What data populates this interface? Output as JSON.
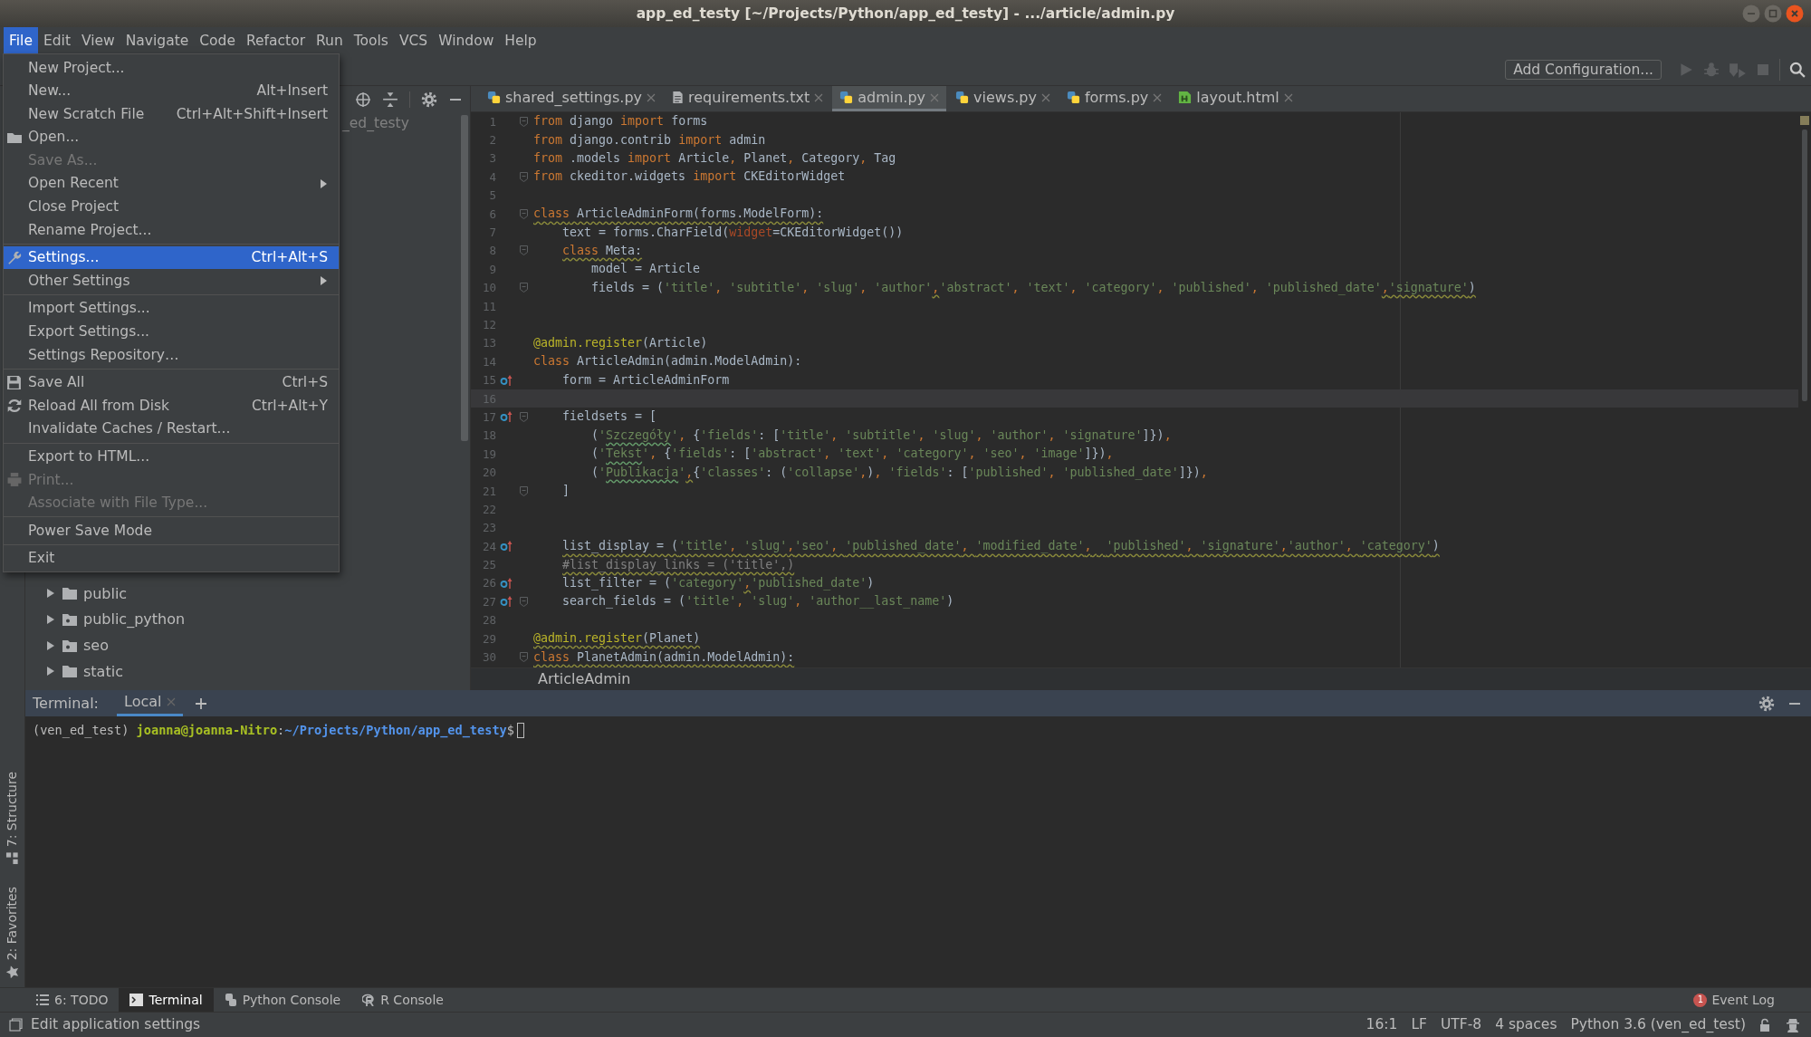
{
  "window": {
    "title": "app_ed_testy [~/Projects/Python/app_ed_testy] - .../article/admin.py"
  },
  "menu_bar": [
    {
      "label": "File",
      "selected": true
    },
    {
      "label": "Edit",
      "selected": false
    },
    {
      "label": "View",
      "selected": false
    },
    {
      "label": "Navigate",
      "selected": false
    },
    {
      "label": "Code",
      "selected": false
    },
    {
      "label": "Refactor",
      "selected": false
    },
    {
      "label": "Run",
      "selected": false
    },
    {
      "label": "Tools",
      "selected": false
    },
    {
      "label": "VCS",
      "selected": false
    },
    {
      "label": "Window",
      "selected": false
    },
    {
      "label": "Help",
      "selected": false
    }
  ],
  "file_menu": {
    "groups": [
      [
        {
          "label": "New Project...",
          "kind": "plain",
          "disabled": false,
          "selected": false,
          "submenu": false
        },
        {
          "label": "New...",
          "shortcut": "Alt+Insert",
          "kind": "plain",
          "disabled": false,
          "selected": false,
          "submenu": false
        },
        {
          "label": "New Scratch File",
          "shortcut": "Ctrl+Alt+Shift+Insert",
          "kind": "plain",
          "disabled": false,
          "selected": false,
          "submenu": false
        },
        {
          "label": "Open...",
          "kind": "folder",
          "disabled": false,
          "selected": false,
          "submenu": false
        },
        {
          "label": "Save As...",
          "kind": "plain",
          "disabled": true,
          "selected": false,
          "submenu": false
        },
        {
          "label": "Open Recent",
          "kind": "plain",
          "disabled": false,
          "selected": false,
          "submenu": true
        },
        {
          "label": "Close Project",
          "kind": "plain",
          "disabled": false,
          "selected": false,
          "submenu": false
        },
        {
          "label": "Rename Project...",
          "kind": "plain",
          "disabled": false,
          "selected": false,
          "submenu": false
        }
      ],
      [
        {
          "label": "Settings...",
          "shortcut": "Ctrl+Alt+S",
          "kind": "wrench",
          "disabled": false,
          "selected": true,
          "submenu": false
        },
        {
          "label": "Other Settings",
          "kind": "plain",
          "disabled": false,
          "selected": false,
          "submenu": true
        }
      ],
      [
        {
          "label": "Import Settings...",
          "kind": "plain",
          "disabled": false,
          "selected": false,
          "submenu": false
        },
        {
          "label": "Export Settings...",
          "kind": "plain",
          "disabled": false,
          "selected": false,
          "submenu": false
        },
        {
          "label": "Settings Repository…",
          "kind": "plain",
          "disabled": false,
          "selected": false,
          "submenu": false
        }
      ],
      [
        {
          "label": "Save All",
          "shortcut": "Ctrl+S",
          "kind": "disk",
          "disabled": false,
          "selected": false,
          "submenu": false
        },
        {
          "label": "Reload All from Disk",
          "shortcut": "Ctrl+Alt+Y",
          "kind": "reload",
          "disabled": false,
          "selected": false,
          "submenu": false
        },
        {
          "label": "Invalidate Caches / Restart...",
          "kind": "plain",
          "disabled": false,
          "selected": false,
          "submenu": false
        }
      ],
      [
        {
          "label": "Export to HTML...",
          "kind": "plain",
          "disabled": false,
          "selected": false,
          "submenu": false
        },
        {
          "label": "Print...",
          "kind": "printer",
          "disabled": true,
          "selected": false,
          "submenu": false
        },
        {
          "label": "Associate with File Type...",
          "kind": "plain",
          "disabled": true,
          "selected": false,
          "submenu": false
        }
      ],
      [
        {
          "label": "Power Save Mode",
          "kind": "plain",
          "disabled": false,
          "selected": false,
          "submenu": false
        }
      ],
      [
        {
          "label": "Exit",
          "kind": "plain",
          "disabled": false,
          "selected": false,
          "submenu": false
        }
      ]
    ]
  },
  "toolbar": {
    "run_configuration": "Add Configuration..."
  },
  "project_panel": {
    "root_label": "_ed_testy",
    "tree": [
      {
        "label": "public",
        "kind": "folder",
        "expanded": false
      },
      {
        "label": "public_python",
        "kind": "package",
        "expanded": false
      },
      {
        "label": "seo",
        "kind": "package",
        "expanded": false
      },
      {
        "label": "static",
        "kind": "folder",
        "expanded": false
      }
    ]
  },
  "editor": {
    "tabs": [
      {
        "label": "shared_settings.py",
        "kind": "python",
        "selected": false
      },
      {
        "label": "requirements.txt",
        "kind": "text",
        "selected": false
      },
      {
        "label": "admin.py",
        "kind": "python",
        "selected": true
      },
      {
        "label": "views.py",
        "kind": "python",
        "selected": false
      },
      {
        "label": "forms.py",
        "kind": "python",
        "selected": false
      },
      {
        "label": "layout.html",
        "kind": "html",
        "selected": false
      }
    ],
    "lines": [
      {
        "number": "1",
        "override": false,
        "fold": true,
        "current": false,
        "tokens": [
          {
            "text": "from",
            "kind": "kw"
          },
          {
            "text": " django ",
            "kind": "plain"
          },
          {
            "text": "import",
            "kind": "kw"
          },
          {
            "text": " forms",
            "kind": "plain"
          }
        ]
      },
      {
        "number": "2",
        "override": false,
        "fold": false,
        "current": false,
        "tokens": [
          {
            "text": "from",
            "kind": "kw"
          },
          {
            "text": " django.contrib ",
            "kind": "plain"
          },
          {
            "text": "import",
            "kind": "kw"
          },
          {
            "text": " admin",
            "kind": "plain"
          }
        ]
      },
      {
        "number": "3",
        "override": false,
        "fold": false,
        "current": false,
        "tokens": [
          {
            "text": "from",
            "kind": "kw"
          },
          {
            "text": " .models ",
            "kind": "plain"
          },
          {
            "text": "import",
            "kind": "kw"
          },
          {
            "text": " Article",
            "kind": "plain"
          },
          {
            "text": ",",
            "kind": "punct"
          },
          {
            "text": " Planet",
            "kind": "plain"
          },
          {
            "text": ",",
            "kind": "punct"
          },
          {
            "text": " Category",
            "kind": "plain"
          },
          {
            "text": ",",
            "kind": "punct"
          },
          {
            "text": " Tag",
            "kind": "plain"
          }
        ]
      },
      {
        "number": "4",
        "override": false,
        "fold": true,
        "current": false,
        "tokens": [
          {
            "text": "from",
            "kind": "kw"
          },
          {
            "text": " ckeditor.widgets ",
            "kind": "plain"
          },
          {
            "text": "import",
            "kind": "kw"
          },
          {
            "text": " CKEditorWidget",
            "kind": "plain"
          }
        ]
      },
      {
        "number": "5",
        "override": false,
        "fold": false,
        "current": false
      },
      {
        "number": "6",
        "override": false,
        "fold": true,
        "current": false,
        "tokens": [
          {
            "text": "class",
            "kind": "wavykw"
          },
          {
            "text": " ArticleAdminForm(forms.ModelForm):",
            "kind": "wavyplain"
          }
        ]
      },
      {
        "number": "7",
        "override": false,
        "fold": false,
        "current": false,
        "tokens": [
          {
            "text": "    text = forms.CharField(",
            "kind": "plain"
          },
          {
            "text": "widget",
            "kind": "param"
          },
          {
            "text": "=CKEditorWidget())",
            "kind": "plain"
          }
        ]
      },
      {
        "number": "8",
        "override": false,
        "fold": true,
        "current": false,
        "tokens": [
          {
            "text": "    class",
            "kind": "wavykw"
          },
          {
            "text": " Meta:",
            "kind": "wavyplain"
          }
        ]
      },
      {
        "number": "9",
        "override": false,
        "fold": false,
        "current": false,
        "tokens": [
          {
            "text": "        model = Article",
            "kind": "plain"
          }
        ]
      },
      {
        "number": "10",
        "override": false,
        "fold": true,
        "current": false,
        "tokens": [
          {
            "text": "        fields = (",
            "kind": "plain"
          },
          {
            "text": "'title'",
            "kind": "str"
          },
          {
            "text": ", ",
            "kind": "punct"
          },
          {
            "text": "'subtitle'",
            "kind": "str"
          },
          {
            "text": ", ",
            "kind": "punct"
          },
          {
            "text": "'slug'",
            "kind": "str"
          },
          {
            "text": ", ",
            "kind": "punct"
          },
          {
            "text": "'author'",
            "kind": "str"
          },
          {
            "text": ",",
            "kind": "wavypunct"
          },
          {
            "text": "'abstract'",
            "kind": "str"
          },
          {
            "text": ", ",
            "kind": "punct"
          },
          {
            "text": "'text'",
            "kind": "str"
          },
          {
            "text": ", ",
            "kind": "punct"
          },
          {
            "text": "'category'",
            "kind": "str"
          },
          {
            "text": ", ",
            "kind": "punct"
          },
          {
            "text": "'published'",
            "kind": "str"
          },
          {
            "text": ", ",
            "kind": "punct"
          },
          {
            "text": "'published_date'",
            "kind": "str"
          },
          {
            "text": ",",
            "kind": "wavypunct"
          },
          {
            "text": "'signature'",
            "kind": "wavystr"
          },
          {
            "text": ")",
            "kind": "wavyplain"
          }
        ]
      },
      {
        "number": "11",
        "override": false,
        "fold": false,
        "current": false
      },
      {
        "number": "12",
        "override": false,
        "fold": false,
        "current": false
      },
      {
        "number": "13",
        "override": false,
        "fold": false,
        "current": false,
        "tokens": [
          {
            "text": "@admin.register",
            "kind": "deco"
          },
          {
            "text": "(Article)",
            "kind": "plain"
          }
        ]
      },
      {
        "number": "14",
        "override": false,
        "fold": false,
        "current": false,
        "tokens": [
          {
            "text": "class",
            "kind": "kw"
          },
          {
            "text": " ArticleAdmin(admin.ModelAdmin):",
            "kind": "plain"
          }
        ]
      },
      {
        "number": "15",
        "override": true,
        "fold": false,
        "current": false,
        "tokens": [
          {
            "text": "    form = ArticleAdminForm",
            "kind": "plain"
          }
        ]
      },
      {
        "number": "16",
        "override": false,
        "fold": false,
        "current": true
      },
      {
        "number": "17",
        "override": true,
        "fold": true,
        "current": false,
        "tokens": [
          {
            "text": "    fieldsets = [",
            "kind": "plain"
          }
        ]
      },
      {
        "number": "18",
        "override": false,
        "fold": false,
        "current": false,
        "tokens": [
          {
            "text": "        (",
            "kind": "plain"
          },
          {
            "text": "'",
            "kind": "str"
          },
          {
            "text": "Szczegóły",
            "kind": "typostr"
          },
          {
            "text": "'",
            "kind": "str"
          },
          {
            "text": ", ",
            "kind": "punct"
          },
          {
            "text": "{",
            "kind": "plain"
          },
          {
            "text": "'fields'",
            "kind": "str"
          },
          {
            "text": ": [",
            "kind": "plain"
          },
          {
            "text": "'title'",
            "kind": "str"
          },
          {
            "text": ", ",
            "kind": "punct"
          },
          {
            "text": "'subtitle'",
            "kind": "str"
          },
          {
            "text": ", ",
            "kind": "punct"
          },
          {
            "text": "'slug'",
            "kind": "str"
          },
          {
            "text": ", ",
            "kind": "punct"
          },
          {
            "text": "'author'",
            "kind": "str"
          },
          {
            "text": ", ",
            "kind": "punct"
          },
          {
            "text": "'signature'",
            "kind": "str"
          },
          {
            "text": "]})",
            "kind": "plain"
          },
          {
            "text": ",",
            "kind": "punct"
          }
        ]
      },
      {
        "number": "19",
        "override": false,
        "fold": false,
        "current": false,
        "tokens": [
          {
            "text": "        (",
            "kind": "plain"
          },
          {
            "text": "'",
            "kind": "str"
          },
          {
            "text": "Tekst",
            "kind": "typostr"
          },
          {
            "text": "'",
            "kind": "str"
          },
          {
            "text": ", ",
            "kind": "punct"
          },
          {
            "text": "{",
            "kind": "plain"
          },
          {
            "text": "'fields'",
            "kind": "str"
          },
          {
            "text": ": [",
            "kind": "plain"
          },
          {
            "text": "'abstract'",
            "kind": "str"
          },
          {
            "text": ", ",
            "kind": "punct"
          },
          {
            "text": "'text'",
            "kind": "str"
          },
          {
            "text": ", ",
            "kind": "punct"
          },
          {
            "text": "'category'",
            "kind": "str"
          },
          {
            "text": ", ",
            "kind": "punct"
          },
          {
            "text": "'seo'",
            "kind": "str"
          },
          {
            "text": ", ",
            "kind": "punct"
          },
          {
            "text": "'image'",
            "kind": "str"
          },
          {
            "text": "]})",
            "kind": "plain"
          },
          {
            "text": ",",
            "kind": "punct"
          }
        ]
      },
      {
        "number": "20",
        "override": false,
        "fold": false,
        "current": false,
        "tokens": [
          {
            "text": "        (",
            "kind": "plain"
          },
          {
            "text": "'",
            "kind": "str"
          },
          {
            "text": "Publikacja",
            "kind": "typostr"
          },
          {
            "text": "'",
            "kind": "str"
          },
          {
            "text": ",",
            "kind": "wavypunct"
          },
          {
            "text": "{",
            "kind": "plain"
          },
          {
            "text": "'classes'",
            "kind": "str"
          },
          {
            "text": ": (",
            "kind": "plain"
          },
          {
            "text": "'collapse'",
            "kind": "str"
          },
          {
            "text": ",",
            "kind": "punct"
          },
          {
            "text": ")",
            "kind": "plain"
          },
          {
            "text": ", ",
            "kind": "punct"
          },
          {
            "text": "'fields'",
            "kind": "str"
          },
          {
            "text": ": [",
            "kind": "plain"
          },
          {
            "text": "'published'",
            "kind": "str"
          },
          {
            "text": ", ",
            "kind": "punct"
          },
          {
            "text": "'published_date'",
            "kind": "str"
          },
          {
            "text": "]})",
            "kind": "plain"
          },
          {
            "text": ",",
            "kind": "punct"
          }
        ]
      },
      {
        "number": "21",
        "override": false,
        "fold": true,
        "current": false,
        "tokens": [
          {
            "text": "    ]",
            "kind": "plain"
          }
        ]
      },
      {
        "number": "22",
        "override": false,
        "fold": false,
        "current": false
      },
      {
        "number": "23",
        "override": false,
        "fold": false,
        "current": false
      },
      {
        "number": "24",
        "override": true,
        "fold": false,
        "current": false,
        "tokens": [
          {
            "text": "    list_display = (",
            "kind": "wavyplain"
          },
          {
            "text": "'title'",
            "kind": "wavystr"
          },
          {
            "text": ", ",
            "kind": "wavypunct"
          },
          {
            "text": "'slug'",
            "kind": "wavystr"
          },
          {
            "text": ",",
            "kind": "wavypunct"
          },
          {
            "text": "'seo'",
            "kind": "wavystr"
          },
          {
            "text": ", ",
            "kind": "wavypunct"
          },
          {
            "text": "'published_date'",
            "kind": "wavystr"
          },
          {
            "text": ", ",
            "kind": "wavypunct"
          },
          {
            "text": "'modified_date'",
            "kind": "wavystr"
          },
          {
            "text": ",  ",
            "kind": "wavypunct"
          },
          {
            "text": "'published'",
            "kind": "wavystr"
          },
          {
            "text": ", ",
            "kind": "wavypunct"
          },
          {
            "text": "'signature'",
            "kind": "wavystr"
          },
          {
            "text": ",",
            "kind": "wavypunct"
          },
          {
            "text": "'author'",
            "kind": "wavystr"
          },
          {
            "text": ", ",
            "kind": "wavypunct"
          },
          {
            "text": "'category'",
            "kind": "wavystr"
          },
          {
            "text": ")",
            "kind": "wavyplain"
          }
        ]
      },
      {
        "number": "25",
        "override": false,
        "fold": false,
        "current": false,
        "tokens": [
          {
            "text": "    #list_display_links = ('title',)",
            "kind": "wavycomment"
          }
        ]
      },
      {
        "number": "26",
        "override": true,
        "fold": false,
        "current": false,
        "tokens": [
          {
            "text": "    list_filter = (",
            "kind": "plain"
          },
          {
            "text": "'category'",
            "kind": "str"
          },
          {
            "text": ",",
            "kind": "wavypunct"
          },
          {
            "text": "'published_date'",
            "kind": "str"
          },
          {
            "text": ")",
            "kind": "plain"
          }
        ]
      },
      {
        "number": "27",
        "override": true,
        "fold": true,
        "current": false,
        "tokens": [
          {
            "text": "    search_fields = (",
            "kind": "plain"
          },
          {
            "text": "'title'",
            "kind": "str"
          },
          {
            "text": ", ",
            "kind": "punct"
          },
          {
            "text": "'slug'",
            "kind": "str"
          },
          {
            "text": ", ",
            "kind": "punct"
          },
          {
            "text": "'author__last_name'",
            "kind": "str"
          },
          {
            "text": ")",
            "kind": "plain"
          }
        ]
      },
      {
        "number": "28",
        "override": false,
        "fold": false,
        "current": false
      },
      {
        "number": "29",
        "override": false,
        "fold": false,
        "current": false,
        "tokens": [
          {
            "text": "@admin.register",
            "kind": "wavydeco"
          },
          {
            "text": "(Planet)",
            "kind": "wavyplain"
          }
        ]
      },
      {
        "number": "30",
        "override": false,
        "fold": true,
        "current": false,
        "tokens": [
          {
            "text": "class",
            "kind": "wavykw"
          },
          {
            "text": " PlanetAdmin(admin.ModelAdmin):",
            "kind": "wavyplain"
          }
        ]
      }
    ],
    "breadcrumb": "ArticleAdmin"
  },
  "terminal": {
    "title": "Terminal:",
    "tabs": [
      {
        "label": "Local",
        "selected": true
      }
    ],
    "prompt": [
      {
        "text": "(ven_ed_test) ",
        "kind": "plain"
      },
      {
        "text": "joanna@joanna-Nitro",
        "kind": "user"
      },
      {
        "text": ":",
        "kind": "plain"
      },
      {
        "text": "~/Projects/Python/app_ed_testy",
        "kind": "path"
      },
      {
        "text": "$",
        "kind": "plain"
      }
    ]
  },
  "side_stripe": [
    {
      "label": "7: Structure",
      "kind": "structure"
    },
    {
      "label": "2: Favorites",
      "kind": "favorites"
    }
  ],
  "tool_tabs": [
    {
      "label": "6: TODO",
      "kind": "todo",
      "selected": false
    },
    {
      "label": "Terminal",
      "kind": "terminal",
      "selected": true
    },
    {
      "label": "Python Console",
      "kind": "python",
      "selected": false
    },
    {
      "label": "R Console",
      "kind": "r",
      "selected": false
    }
  ],
  "event_log": {
    "label": "Event Log",
    "count": "1"
  },
  "status_bar": {
    "message": "Edit application settings",
    "items": [
      "16:1",
      "LF",
      "UTF-8",
      "4 spaces",
      "Python 3.6 (ven_ed_test)"
    ]
  }
}
